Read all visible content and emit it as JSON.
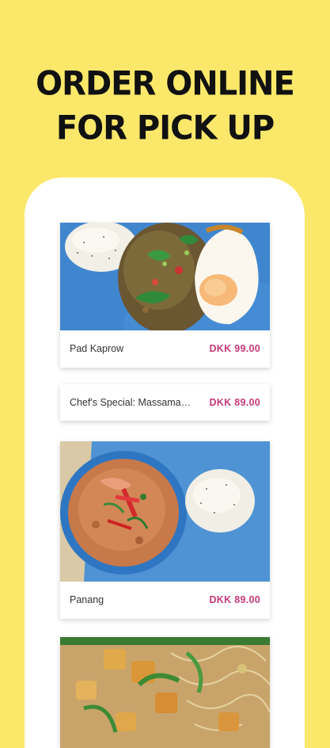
{
  "headline": {
    "line1": "ORDER ONLINE",
    "line2": "FOR PICK UP"
  },
  "menu": {
    "items": [
      {
        "name": "Pad Kaprow",
        "price": "DKK 99.00"
      },
      {
        "name": "Chef's Special: Massaman Curry",
        "price": "DKK 89.00"
      },
      {
        "name": "Panang",
        "price": "DKK 89.00"
      }
    ]
  },
  "colors": {
    "background": "#fbe86a",
    "price": "#c53a7a",
    "plate_blue": "#3f86cf"
  }
}
